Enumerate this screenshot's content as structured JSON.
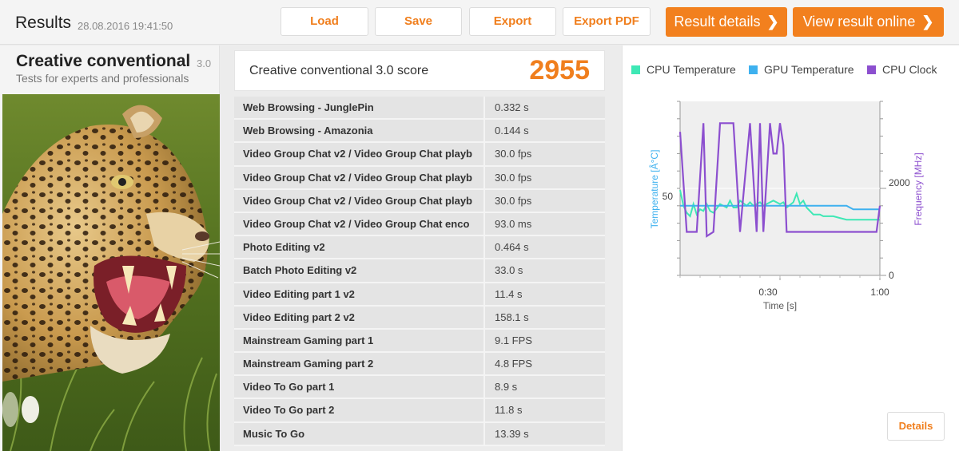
{
  "header": {
    "title": "Results",
    "date": "28.08.2016 19:41:50",
    "buttons": {
      "load": "Load",
      "save": "Save",
      "export": "Export",
      "export_pdf": "Export PDF",
      "result_details": "Result details",
      "view_online": "View result online"
    }
  },
  "test": {
    "name": "Creative conventional",
    "version": "3.0",
    "subtitle": "Tests for experts and professionals"
  },
  "score": {
    "label": "Creative conventional 3.0 score",
    "value": "2955"
  },
  "results": [
    {
      "name": "Web Browsing - JunglePin",
      "value": "0.332 s"
    },
    {
      "name": "Web Browsing - Amazonia",
      "value": "0.144 s"
    },
    {
      "name": "Video Group Chat v2 / Video Group Chat playb",
      "value": "30.0 fps"
    },
    {
      "name": "Video Group Chat v2 / Video Group Chat playb",
      "value": "30.0 fps"
    },
    {
      "name": "Video Group Chat v2 / Video Group Chat playb",
      "value": "30.0 fps"
    },
    {
      "name": "Video Group Chat v2 / Video Group Chat enco",
      "value": "93.0 ms"
    },
    {
      "name": "Photo Editing v2",
      "value": "0.464 s"
    },
    {
      "name": "Batch Photo Editing v2",
      "value": "33.0 s"
    },
    {
      "name": "Video Editing part 1 v2",
      "value": "11.4 s"
    },
    {
      "name": "Video Editing part 2 v2",
      "value": "158.1 s"
    },
    {
      "name": "Mainstream Gaming part 1",
      "value": "9.1 FPS"
    },
    {
      "name": "Mainstream Gaming part 2",
      "value": "4.8 FPS"
    },
    {
      "name": "Video To Go part 1",
      "value": "8.9 s"
    },
    {
      "name": "Video To Go part 2",
      "value": "11.8 s"
    },
    {
      "name": "Music To Go",
      "value": "13.39 s"
    }
  ],
  "chart": {
    "details_label": "Details",
    "legend": [
      {
        "label": "CPU Temperature",
        "color": "#3ee8b5"
      },
      {
        "label": "GPU Temperature",
        "color": "#3eb1ef"
      },
      {
        "label": "CPU Clock",
        "color": "#8c4fcf"
      }
    ],
    "left_axis_label": "Temperature [Â°C]",
    "right_axis_label": "Frequency [MHz]",
    "x_axis_label": "Time [s]",
    "left_tick_label": "50",
    "right_tick_labels": [
      "2000",
      "0"
    ],
    "x_tick_labels": [
      "0:30",
      "1:00"
    ]
  },
  "chart_data": {
    "type": "line",
    "xlabel": "Time [s]",
    "ylabel": "Temperature [Â°C]",
    "y2label": "Frequency [MHz]",
    "xlim": [
      0,
      60
    ],
    "ylim": [
      0,
      100
    ],
    "y2lim": [
      0,
      4000
    ],
    "x_ticks": [
      {
        "value": 30,
        "label": "0:30"
      },
      {
        "value": 60,
        "label": "1:00"
      }
    ],
    "y_ticks": [
      50
    ],
    "y2_ticks": [
      0,
      2000
    ],
    "series": [
      {
        "name": "CPU Temperature",
        "axis": "left",
        "x": [
          0,
          1,
          2,
          3,
          4,
          5,
          6,
          7,
          8,
          9,
          10,
          12,
          14,
          15,
          16,
          17,
          18,
          20,
          21,
          22,
          24,
          25,
          26,
          28,
          30,
          31,
          32,
          34,
          35,
          36,
          37,
          38,
          40,
          42,
          43,
          44,
          46,
          48,
          50,
          52,
          54,
          56,
          58,
          60
        ],
        "y": [
          49,
          40,
          36,
          34,
          41,
          35,
          38,
          37,
          41,
          37,
          36,
          41,
          39,
          43,
          39,
          39,
          43,
          40,
          42,
          40,
          42,
          40,
          41,
          43,
          41,
          42,
          39,
          42,
          47,
          41,
          43,
          39,
          35,
          35,
          34,
          34,
          34,
          33,
          32,
          32,
          32,
          32,
          32,
          32
        ]
      },
      {
        "name": "GPU Temperature",
        "axis": "left",
        "x": [
          0,
          5,
          10,
          20,
          30,
          40,
          50,
          52,
          54,
          56,
          58,
          60
        ],
        "y": [
          40,
          40,
          40,
          40,
          40,
          40,
          40,
          38,
          38,
          38,
          38,
          38
        ]
      },
      {
        "name": "CPU Clock",
        "axis": "right",
        "x": [
          0,
          2,
          3,
          5,
          7,
          8,
          9,
          10,
          12,
          13,
          15,
          16,
          18,
          21,
          23,
          24,
          25,
          27,
          28,
          29,
          30,
          31,
          32,
          34,
          35,
          36,
          38,
          39,
          40,
          42,
          44,
          46,
          48,
          50,
          52,
          54,
          56,
          58,
          59,
          60
        ],
        "y": [
          3300,
          1000,
          1000,
          1000,
          3500,
          900,
          950,
          1000,
          3500,
          3500,
          3500,
          3500,
          1000,
          3500,
          1000,
          3500,
          1000,
          3500,
          2800,
          2800,
          3500,
          3000,
          1000,
          1000,
          1000,
          1000,
          1000,
          1000,
          1000,
          1000,
          1000,
          1000,
          1000,
          1000,
          1000,
          1000,
          1000,
          1000,
          1000,
          1600
        ]
      }
    ]
  }
}
